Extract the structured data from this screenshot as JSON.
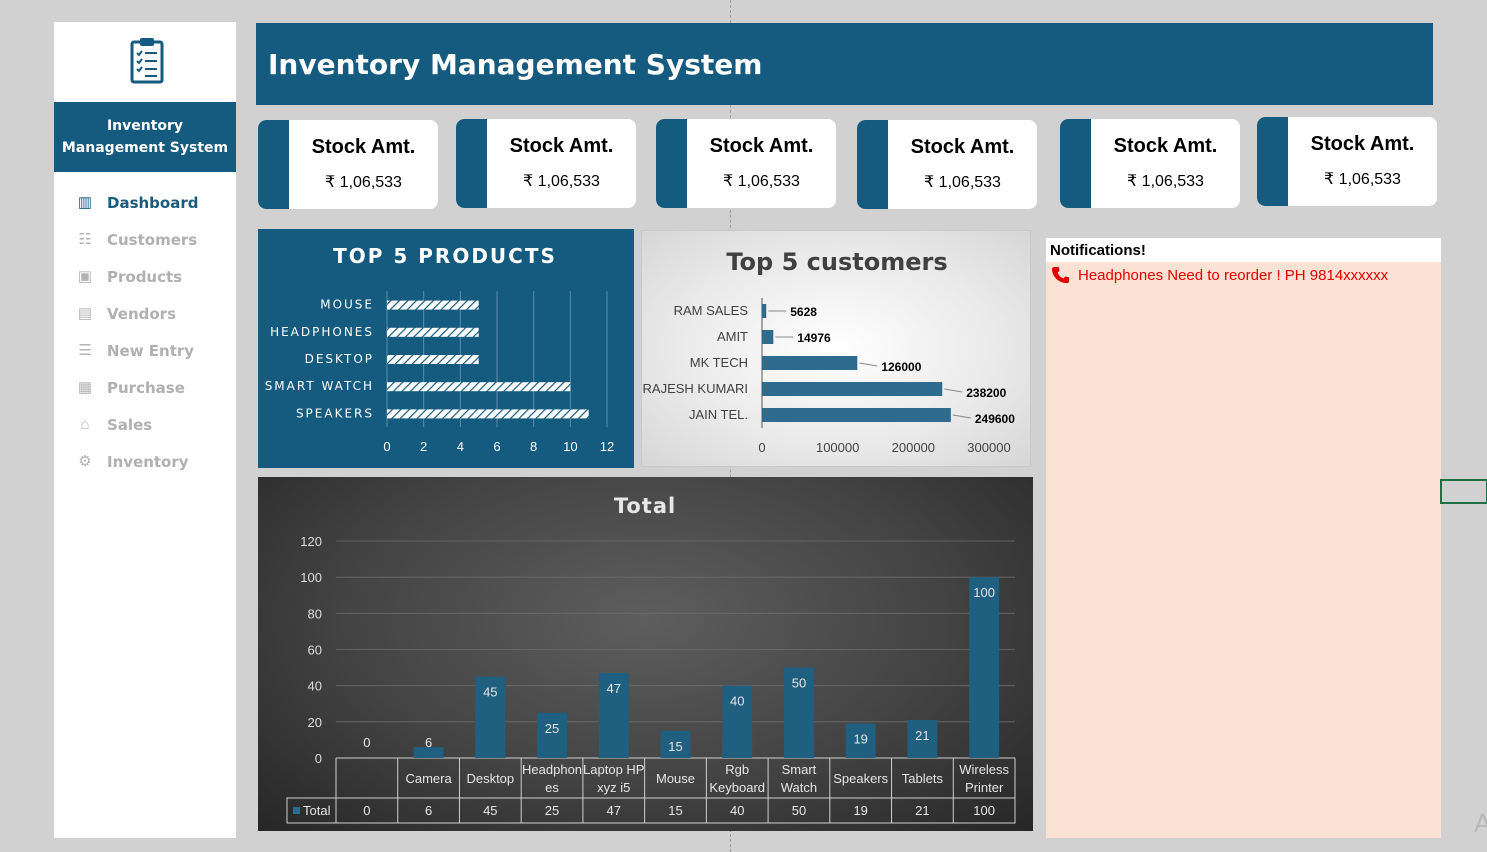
{
  "app": {
    "title": "Inventory Management System"
  },
  "sidebar": {
    "title": "Inventory Management System",
    "items": [
      {
        "label": "Dashboard",
        "icon": "bar-chart-icon",
        "active": true
      },
      {
        "label": "Customers",
        "icon": "users-icon",
        "active": false
      },
      {
        "label": "Products",
        "icon": "products-icon",
        "active": false
      },
      {
        "label": "Vendors",
        "icon": "store-icon",
        "active": false
      },
      {
        "label": "New Entry",
        "icon": "menu-icon",
        "active": false
      },
      {
        "label": "Purchase",
        "icon": "receipt-icon",
        "active": false
      },
      {
        "label": "Sales",
        "icon": "house-icon",
        "active": false
      },
      {
        "label": "Inventory",
        "icon": "gear-icon",
        "active": false
      }
    ]
  },
  "kpis": [
    {
      "title": "Stock Amt.",
      "value": "₹ 1,06,533"
    },
    {
      "title": "Stock Amt.",
      "value": "₹ 1,06,533"
    },
    {
      "title": "Stock Amt.",
      "value": "₹ 1,06,533"
    },
    {
      "title": "Stock Amt.",
      "value": "₹ 1,06,533"
    },
    {
      "title": "Stock Amt.",
      "value": "₹ 1,06,533"
    },
    {
      "title": "Stock Amt.",
      "value": "₹ 1,06,533"
    }
  ],
  "notifications": {
    "title": "Notifications!",
    "items": [
      {
        "text": "Headphones Need to reorder ! PH 9814xxxxxx",
        "icon": "phone-icon"
      }
    ]
  },
  "colors": {
    "brand": "#155a7f",
    "bar": "#2a6a8c",
    "alert": "#e00000",
    "notif_bg": "#fbe2d5"
  },
  "chart_data": [
    {
      "id": "top5products",
      "type": "bar",
      "orientation": "horizontal",
      "title": "TOP 5 PRODUCTS",
      "categories": [
        "MOUSE",
        "HEADPHONES",
        "DESKTOP",
        "SMART WATCH",
        "SPEAKERS"
      ],
      "values": [
        5,
        5,
        5,
        10,
        11
      ],
      "xticks": [
        "0",
        "2",
        "4",
        "6",
        "8",
        "10",
        "12"
      ],
      "xlim": [
        0,
        12
      ],
      "grid": true
    },
    {
      "id": "top5customers",
      "type": "bar",
      "orientation": "horizontal",
      "title": "Top 5 customers",
      "categories": [
        "RAM SALES",
        "AMIT",
        "MK TECH",
        "RAJESH KUMARI",
        "JAIN TEL."
      ],
      "values": [
        5628,
        14976,
        126000,
        238200,
        249600
      ],
      "xticks": [
        "0",
        "100000",
        "200000",
        "300000"
      ],
      "xlim": [
        0,
        300000
      ],
      "grid": false
    },
    {
      "id": "total",
      "type": "bar",
      "title": "Total",
      "categories": [
        " ",
        "Camera",
        "Desktop",
        "Headphon es",
        "Laptop HP xyz i5",
        "Mouse",
        "Rgb Keyboard",
        "Smart Watch",
        "Speakers",
        "Tablets",
        "Wireless Printer"
      ],
      "series": [
        {
          "name": "Total",
          "values": [
            0,
            6,
            45,
            25,
            47,
            15,
            40,
            50,
            19,
            21,
            100
          ]
        }
      ],
      "yticks": [
        "0",
        "20",
        "40",
        "60",
        "80",
        "100",
        "120"
      ],
      "ylim": [
        0,
        120
      ],
      "grid": true,
      "data_table": true
    }
  ]
}
